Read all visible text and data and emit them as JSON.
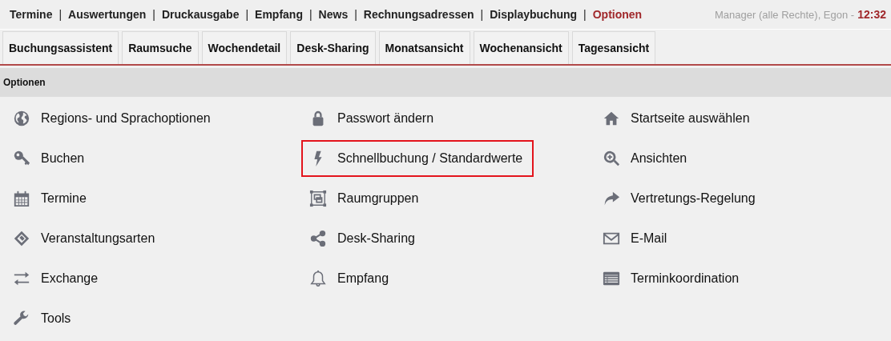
{
  "top_nav": {
    "items": [
      {
        "label": "Termine",
        "selected": false,
        "separator": "|"
      },
      {
        "label": "Auswertungen",
        "selected": false,
        "separator": "|"
      },
      {
        "label": "Druckausgabe",
        "selected": false,
        "separator": "|"
      },
      {
        "label": "Empfang",
        "selected": false,
        "separator": "|"
      },
      {
        "label": "News",
        "selected": false,
        "separator": "|"
      },
      {
        "label": "Rechnungsadressen",
        "selected": false,
        "separator": "|"
      },
      {
        "label": "Displaybuchung",
        "selected": false,
        "separator": "|"
      },
      {
        "label": "Optionen",
        "selected": true
      }
    ],
    "user": "Manager (alle Rechte), Egon -",
    "time": "12:32"
  },
  "tabs": [
    {
      "label": "Buchungsassistent",
      "selected": false
    },
    {
      "label": "Raumsuche",
      "selected": false
    },
    {
      "label": "Wochendetail",
      "selected": false
    },
    {
      "label": "Desk-Sharing",
      "selected": false
    },
    {
      "label": "Monatsansicht",
      "selected": false
    },
    {
      "label": "Wochenansicht",
      "selected": false
    },
    {
      "label": "Tagesansicht",
      "selected": false
    }
  ],
  "section": {
    "title": "Optionen"
  },
  "options": [
    {
      "label": "Regions- und Sprachoptionen",
      "highlighted": false
    },
    {
      "label": "Passwort ändern",
      "highlighted": false
    },
    {
      "label": "Startseite auswählen",
      "highlighted": false
    },
    {
      "label": "Buchen",
      "highlighted": false
    },
    {
      "label": "Schnellbuchung / Standardwerte",
      "highlighted": true
    },
    {
      "label": "Ansichten",
      "highlighted": false
    },
    {
      "label": "Termine",
      "highlighted": false
    },
    {
      "label": "Raumgruppen",
      "highlighted": false
    },
    {
      "label": "Vertretungs-Regelung",
      "highlighted": false
    },
    {
      "label": "Veranstaltungsarten",
      "highlighted": false
    },
    {
      "label": "Desk-Sharing",
      "highlighted": false
    },
    {
      "label": "E-Mail",
      "highlighted": false
    },
    {
      "label": "Exchange",
      "highlighted": false
    },
    {
      "label": "Empfang",
      "highlighted": false
    },
    {
      "label": "Terminkoordination",
      "highlighted": false
    },
    {
      "label": "Tools",
      "highlighted": false
    }
  ]
}
